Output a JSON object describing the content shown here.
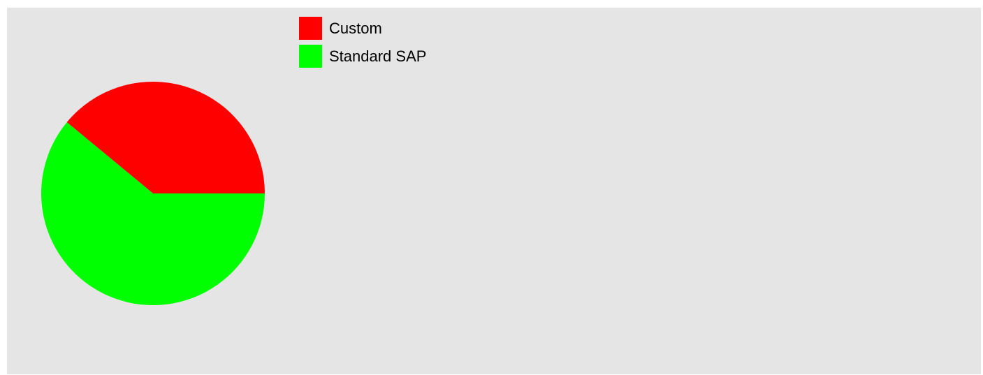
{
  "chart_data": {
    "type": "pie",
    "categories": [
      "Custom",
      "Standard SAP"
    ],
    "values": [
      39,
      61
    ],
    "colors": [
      "#ff0000",
      "#00ff00"
    ],
    "start_angle_deg": 0,
    "direction": "counterclockwise",
    "legend_position": "top",
    "background_color": "#e5e5e5"
  }
}
